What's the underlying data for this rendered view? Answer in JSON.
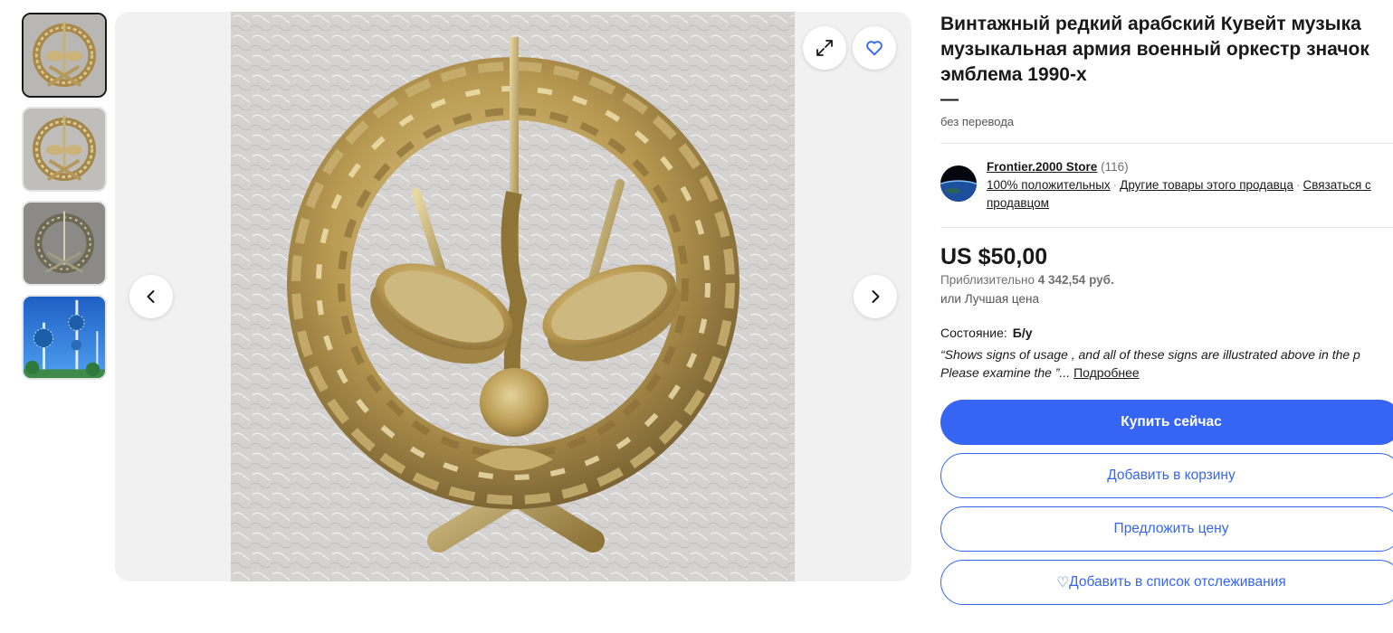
{
  "listing": {
    "title": "Винтажный редкий арабский Кувейт музыка музыкальная армия военный оркестр значок эмблема 1990-х",
    "dash": "—",
    "translation_note": "без перевода"
  },
  "seller": {
    "name": "Frontier.2000 Store",
    "feedback_count": "(116)",
    "positive": "100% положительных",
    "other_items": "Другие товары этого продавца",
    "contact": "Связаться с продавцом"
  },
  "price": {
    "main": "US $50,00",
    "approx_label": "Приблизительно",
    "approx_value": "4 342,54 руб.",
    "best_offer": "или Лучшая цена"
  },
  "condition": {
    "label": "Состояние:",
    "value": "Б/у",
    "quote": "“Shows signs of usage , and all of these signs are illustrated above in the p",
    "quote_line2": "Please examine the ”...",
    "more": "Подробнее"
  },
  "buttons": {
    "buy_now": "Купить сейчас",
    "add_to_cart": "Добавить в корзину",
    "make_offer": "Предложить цену",
    "watchlist": "Добавить в список отслеживания",
    "watchlist_icon": "♡"
  },
  "gallery": {
    "thumbnail_count": 4,
    "selected_index": 0,
    "icons": [
      "expand-icon",
      "heart-icon",
      "chevron-left-icon",
      "chevron-right-icon"
    ]
  },
  "colors": {
    "accent": "#3665f3",
    "text": "#191919",
    "muted": "#707070"
  }
}
